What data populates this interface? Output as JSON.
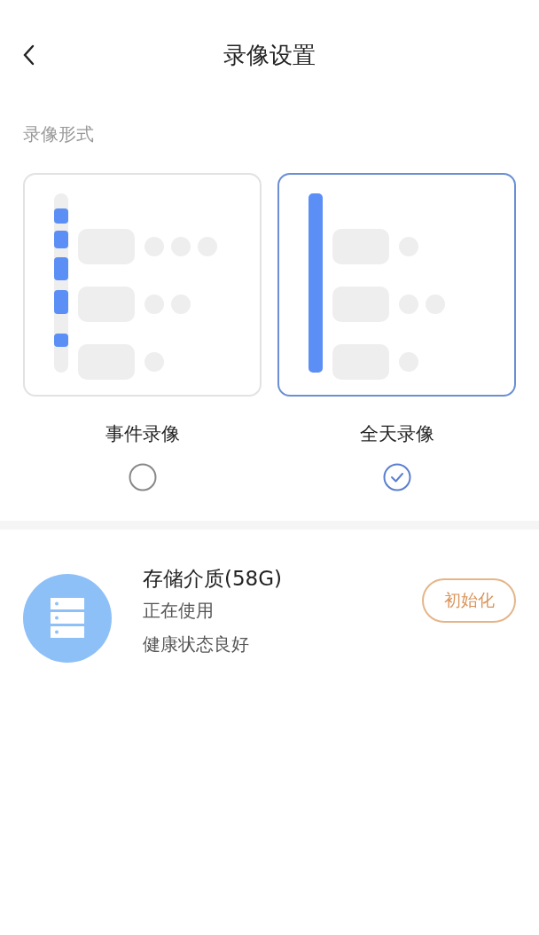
{
  "header": {
    "title": "录像设置"
  },
  "section": {
    "label": "录像形式"
  },
  "options": [
    {
      "kind": "event",
      "label": "事件录像",
      "selected": false
    },
    {
      "kind": "continuous",
      "label": "全天录像",
      "selected": true
    }
  ],
  "storage": {
    "title": "存储介质(58G)",
    "status": "正在使用",
    "health": "健康状态良好",
    "button": "初始化"
  }
}
